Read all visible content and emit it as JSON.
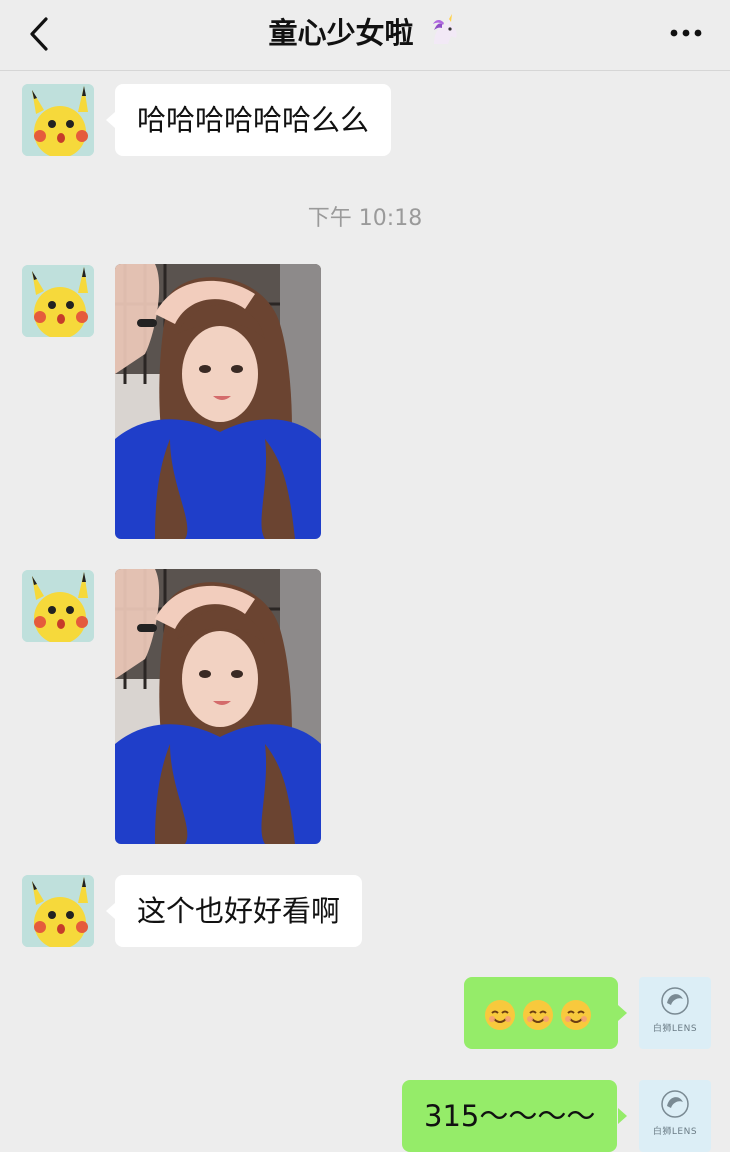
{
  "header": {
    "title": "童心少女啦",
    "title_emoji": "unicorn-emoji",
    "back_icon": "chevron-left-icon",
    "more_icon": "more-dots-icon"
  },
  "messages": [
    {
      "side": "left",
      "type": "text",
      "text": "哈哈哈哈哈哈么么"
    },
    {
      "type": "timestamp",
      "text": "下午 10:18"
    },
    {
      "side": "left",
      "type": "image",
      "description": "photo"
    },
    {
      "side": "left",
      "type": "image",
      "description": "photo"
    },
    {
      "side": "left",
      "type": "text",
      "text": "这个也好好看啊"
    },
    {
      "side": "right",
      "type": "emoji",
      "emojis": [
        "smiling-face-emoji",
        "smiling-face-emoji",
        "smiling-face-emoji"
      ]
    },
    {
      "side": "right",
      "type": "text",
      "text": "315～～～～"
    }
  ],
  "self_avatar": {
    "logo_text": "白狮LENS"
  },
  "colors": {
    "background": "#ededed",
    "incoming_bubble": "#ffffff",
    "outgoing_bubble": "#95ec69",
    "timestamp": "#9a9a9a"
  }
}
